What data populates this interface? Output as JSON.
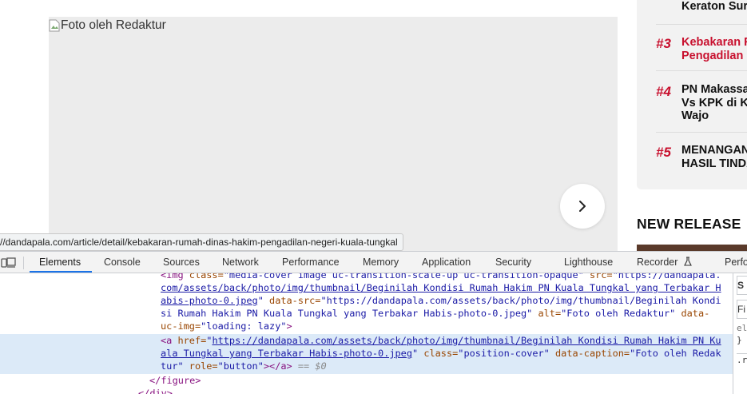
{
  "article": {
    "image_alt": "Foto oleh Redaktur"
  },
  "sidebar": {
    "items": [
      {
        "num": "",
        "title_lines": [
          "Keraton Sur"
        ]
      },
      {
        "num": "#3",
        "title_lines": [
          "Kebakaran R",
          "Pengadilan N"
        ],
        "color": "#c8102e"
      },
      {
        "num": "#4",
        "title_lines": [
          "PN Makassa",
          "Vs KPK di Ka",
          "Wajo"
        ],
        "color": "#111111"
      },
      {
        "num": "#5",
        "title_lines": [
          "MENANGAN",
          "HASIL TINDA"
        ],
        "color": "#111111"
      }
    ]
  },
  "new_release": "NEW RELEASE",
  "status_url": "//dandapala.com/article/detail/kebakaran-rumah-dinas-hakim-pengadilan-negeri-kuala-tungkal",
  "devtools": {
    "tabs": [
      "Elements",
      "Console",
      "Sources",
      "Network",
      "Performance",
      "Memory",
      "Application",
      "Security",
      "Lighthouse",
      "Recorder",
      "Perfo"
    ],
    "active_tab": "Elements",
    "code": {
      "l1_tag": "<img",
      "l1_an1": " class=",
      "l1_av1": "\"media-cover image uc-transition-scale-up uc-transition-opaque\"",
      "l1_an2": " src=",
      "l1_av2": "\"https://dandapala.",
      "l2_link": "com/assets/back/photo/img/thumbnail/Beginilah Kondisi Rumah Hakim PN Kuala Tungkal yang Terbakar H",
      "l3_link": "abis-photo-0.jpeg",
      "l3_av0": "\"",
      "l3_an": " data-src=",
      "l3_av": "\"https://dandapala.com/assets/back/photo/img/thumbnail/Beginilah Kondi",
      "l4_av": "si Rumah Hakim PN Kuala Tungkal yang Terbakar Habis-photo-0.jpeg\"",
      "l4_an": " alt=",
      "l4_av2": "\"Foto oleh Redaktur\"",
      "l4_an2": " data-",
      "l5_an": "uc-img=",
      "l5_av": "\"loading: lazy\"",
      "l5_tag": ">",
      "l6_tag": "<a",
      "l6_an": " href=",
      "l6_av0": "\"",
      "l6_link": "https://dandapala.com/assets/back/photo/img/thumbnail/Beginilah Kondisi Rumah Hakim PN Ku",
      "l7_link": "ala Tungkal yang Terbakar Habis-photo-0.jpeg",
      "l7_av0": "\"",
      "l7_an": " class=",
      "l7_av": "\"position-cover\"",
      "l7_an2": " data-caption=",
      "l7_av2": "\"Foto oleh Redak",
      "l8_av": "tur\"",
      "l8_an": " role=",
      "l8_av2": "\"button\"",
      "l8_tag": "></a>",
      "l8_eq": " == ",
      "l8_dollar": "$0",
      "l9_tag": "</figure>",
      "l10_tag": "</div>"
    },
    "right_pane": [
      "S",
      "Fi",
      "el",
      "}",
      ".r"
    ]
  }
}
